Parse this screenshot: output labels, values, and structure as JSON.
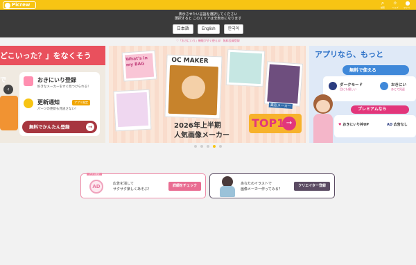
{
  "header": {
    "logo_text": "Picrew",
    "icons": [
      {
        "name": "search-icon",
        "glyph": "⌕",
        "label": "検索"
      },
      {
        "name": "lightbulb-icon",
        "glyph": "✧",
        "label": "ヘルプ"
      },
      {
        "name": "user-icon",
        "glyph": "●",
        "label": "マイページ"
      }
    ],
    "accent_color": "#f7c413"
  },
  "language_bar": {
    "message_line1": "表示させたい言語を選択してください",
    "message_line2": "選択すると このエリアは非表示になります",
    "buttons": [
      "日本語",
      "English",
      "한국어"
    ]
  },
  "notice": "♡「おきにいり」機能がすぐ使える！無料会員登録",
  "banner_left": {
    "headline": "どこいった？」をなくそう",
    "left_text": "で",
    "feature1_title": "おきにいり登録",
    "feature1_desc": "好きなメーカーをすぐ見つけられる！",
    "feature2_title": "更新通知",
    "feature2_badge": "アプリ限定",
    "feature2_desc": "パーツの更新も見逃さない！",
    "cta": "無料でかんたん登録",
    "cta_arrow": "→",
    "nav_prev": "‹"
  },
  "banner_mid": {
    "polaroid1_text": "What's in my BAG",
    "polaroid3_text": "OC MAKER",
    "polaroid5_text": "異形メーカー",
    "year_text": "2026年上半期",
    "sub_text": "人気画像メーカー",
    "top10": "TOP10",
    "arrow": "→"
  },
  "banner_right": {
    "title": "アプリなら、もっと",
    "pill1": "無料で使える",
    "feat1_title": "ダークモード",
    "feat1_desc": "目にも優しい",
    "feat2_title": "おきにい",
    "feat2_desc": "あとで見返",
    "pill2": "プレミアムなら",
    "f2a": "おきにいり枠UP",
    "f2b": "広告なし",
    "f2b_icon": "AD"
  },
  "carousel": {
    "dot_count": 5,
    "active_index": 3
  },
  "promo1": {
    "tag": "アプリ限定",
    "icon_text": "AD",
    "text_line1": "広告を消して",
    "text_line2": "サクサク楽しくあそぶ！",
    "button": "詳細をチェック"
  },
  "promo2": {
    "text_line1": "あなたのイラストで",
    "text_line2": "画像メーカー作ってみる？",
    "button": "クリエイター登録"
  }
}
